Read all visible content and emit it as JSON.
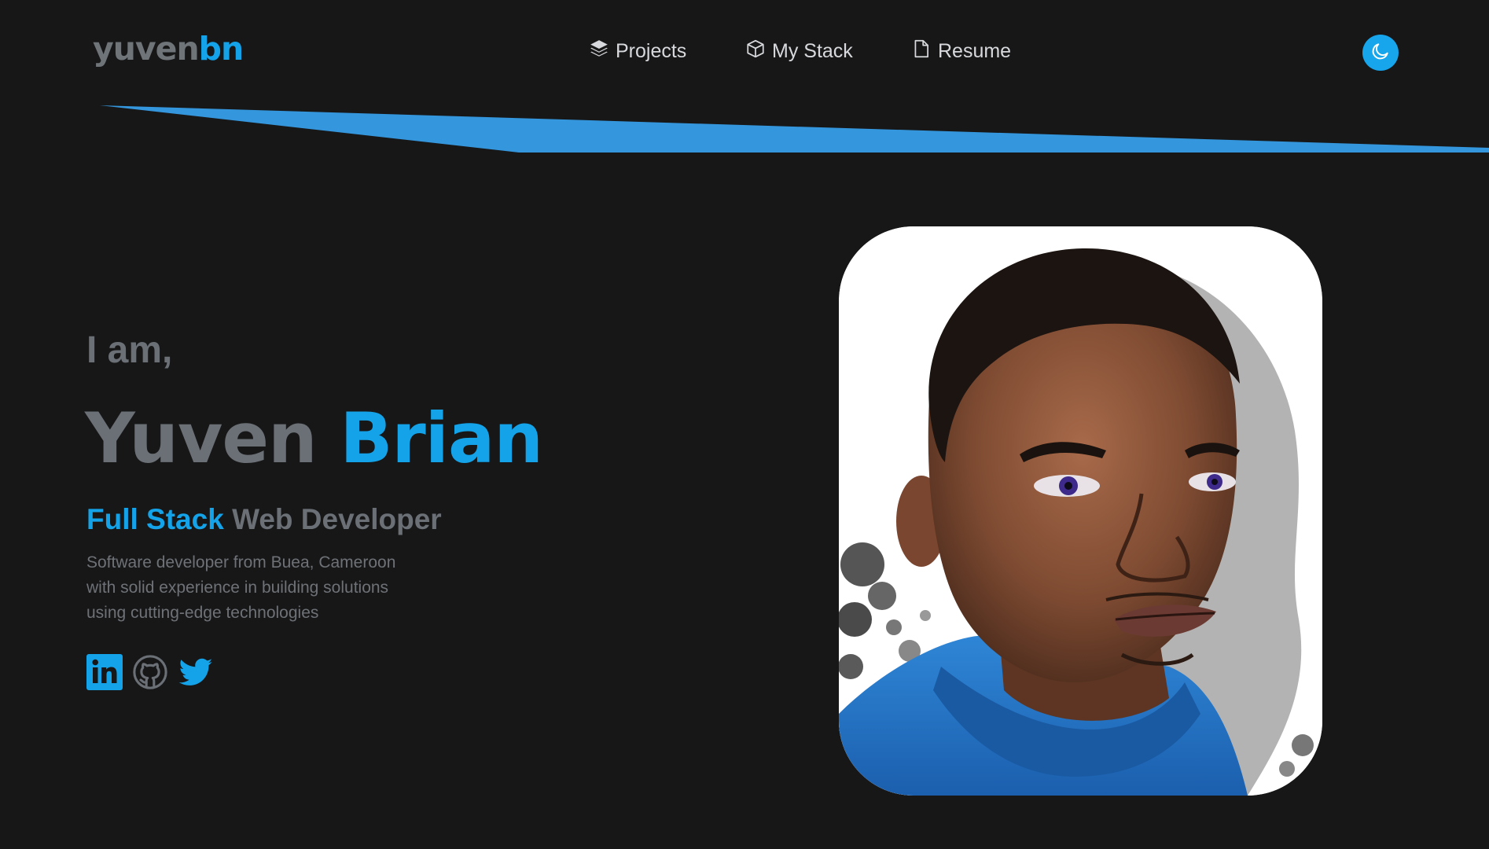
{
  "header": {
    "logo_part1": "yuven",
    "logo_part2": "bn",
    "nav": [
      {
        "label": "Projects",
        "icon": "layers-icon"
      },
      {
        "label": "My Stack",
        "icon": "cube-icon"
      },
      {
        "label": "Resume",
        "icon": "file-icon"
      }
    ],
    "theme_toggle_icon": "moon-icon"
  },
  "hero": {
    "intro": "I am,",
    "first_name": "Yuven",
    "last_name": "Brian",
    "role_accent": "Full Stack",
    "role_rest": "Web Developer",
    "bio_lines": [
      "Software developer from Buea, Cameroon",
      "with solid experience in building solutions",
      "using cutting-edge technologies"
    ],
    "socials": [
      {
        "name": "LinkedIn",
        "icon": "linkedin-icon"
      },
      {
        "name": "GitHub",
        "icon": "github-icon"
      },
      {
        "name": "Twitter",
        "icon": "twitter-icon"
      }
    ]
  },
  "colors": {
    "background": "#171718",
    "accent": "#14a3e8",
    "banner": "#3496dc",
    "muted_text": "#6b7076",
    "nav_text": "#d7d9dc"
  }
}
